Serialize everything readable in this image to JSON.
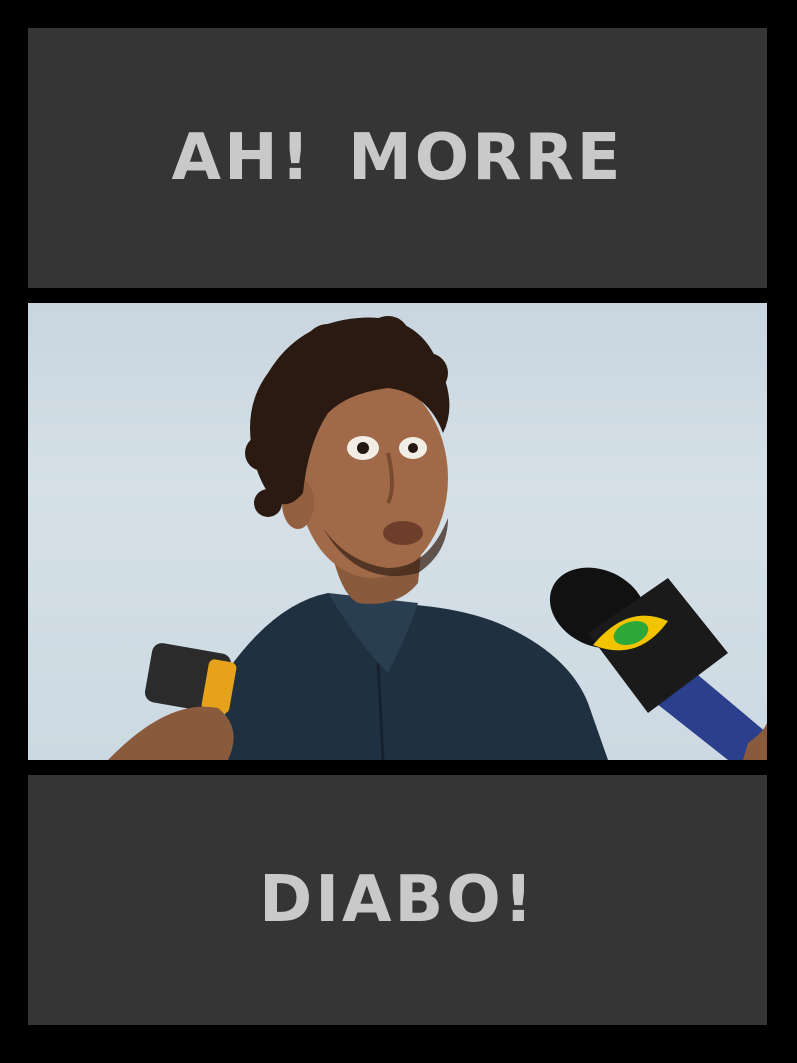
{
  "meme": {
    "top_caption": "AH! MORRE",
    "bottom_caption": "DIABO!"
  },
  "photo": {
    "subject": "man with curly hair making a surprised face, interviewed with microphones",
    "mic_logo_icon": "eye-logo-icon"
  },
  "colors": {
    "background": "#000000",
    "panel": "#353535",
    "caption_text": "#c9c9c9",
    "sky": "#d3dee6",
    "jacket": "#1f3040",
    "mic_logo_yellow": "#f2c400",
    "mic_logo_green": "#2fa83a"
  }
}
